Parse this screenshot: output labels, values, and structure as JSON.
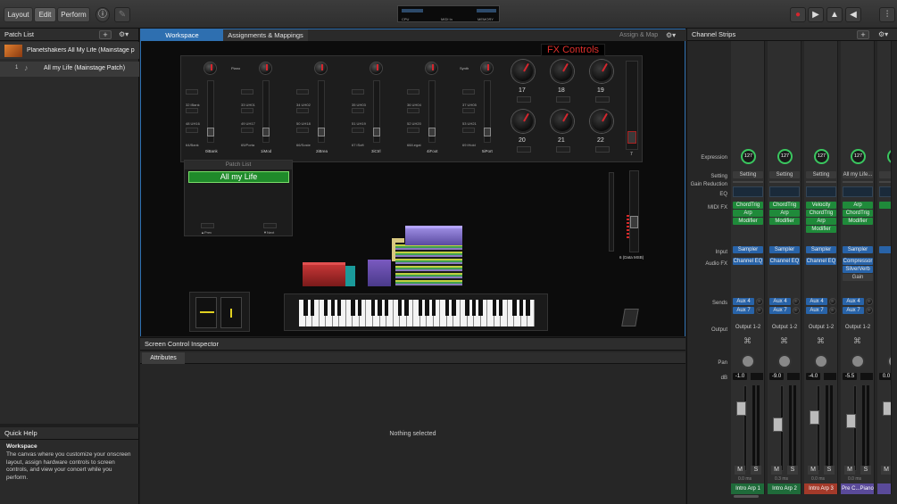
{
  "toolbar": {
    "layout": "Layout",
    "edit": "Edit",
    "perform": "Perform",
    "info_icon": "info-icon",
    "pencil_icon": "pencil-icon",
    "meters": {
      "cpu": "CPU",
      "midi": "MIDI In",
      "memory": "MEMORY"
    },
    "transport": [
      "record-icon",
      "play-icon",
      "metronome-icon",
      "back-icon"
    ],
    "mixer_icon": "mixer-icon"
  },
  "patch_list": {
    "title": "Patch List",
    "concert": "Planetshakers All My Life (Mainstage p",
    "patches": [
      {
        "number": "1",
        "name": "All my Life (Mainstage Patch)"
      }
    ]
  },
  "quick_help": {
    "title": "Quick Help",
    "subtitle": "Workspace",
    "body": "The canvas where you customize your onscreen layout, assign hardware controls to screen controls, and view your concert while you perform."
  },
  "workspace": {
    "tabs": [
      "Workspace",
      "Assignments & Mappings"
    ],
    "assign_map": "Assign & Map",
    "fx_title": "FX Controls",
    "top_labels": [
      "Piano",
      "Synth"
    ],
    "strip_buttons": [
      {
        "a": "32 iBank",
        "b": "48 UH16",
        "c": "64/Bank",
        "name": "0iBank"
      },
      {
        "a": "33 UH01",
        "b": "49 UH17",
        "c": "65/Porta",
        "name": "1iMod"
      },
      {
        "a": "34 UH02",
        "b": "50 UH18",
        "c": "66/Soste",
        "name": "2iBrea"
      },
      {
        "a": "35 UH03",
        "b": "51 UH19",
        "c": "67 iSoft",
        "name": "3iCtrl"
      },
      {
        "a": "36 UH04",
        "b": "52 UH20",
        "c": "68/Legat",
        "name": "4iFoot"
      },
      {
        "a": "37 UH05",
        "b": "53 UH21",
        "c": "69 iHold",
        "name": "5iPort"
      }
    ],
    "fx_knobs": [
      "17",
      "18",
      "19",
      "20",
      "21",
      "22"
    ],
    "slider_seven": "7",
    "patch_list_title": "Patch List",
    "patch_current": "All my Life",
    "prev": "▲Prev",
    "next": "▼Next",
    "data_msb": "6 (Data MSB)"
  },
  "inspector": {
    "title": "Screen Control Inspector",
    "tab": "Attributes",
    "empty": "Nothing selected"
  },
  "channel_strips": {
    "title": "Channel Strips",
    "row_labels": {
      "expression": "Expression",
      "setting": "Setting",
      "gain_reduction": "Gain Reduction",
      "eq": "EQ",
      "midi_fx": "MIDI FX",
      "input": "Input",
      "audio_fx": "Audio FX",
      "sends": "Sends",
      "output": "Output",
      "pan": "Pan",
      "db": "dB"
    },
    "strips": [
      {
        "expression": "127",
        "setting": "Setting",
        "midi_fx": [
          "ChordTrig",
          "Arp",
          "Modifier"
        ],
        "input": "Sampler",
        "audio_fx": [
          "Channel EQ"
        ],
        "sends": [
          "Aux 4",
          "Aux 7"
        ],
        "output": "Output 1-2",
        "db": "-1.0",
        "delay": "0.0 ms",
        "name": "Intro Arp 1",
        "color": "#1f6b3a"
      },
      {
        "expression": "127",
        "setting": "Setting",
        "midi_fx": [
          "ChordTrig",
          "Arp",
          "Modifier"
        ],
        "input": "Sampler",
        "audio_fx": [
          "Channel EQ"
        ],
        "sends": [
          "Aux 4",
          "Aux 7"
        ],
        "output": "Output 1-2",
        "db": "-9.0",
        "delay": "0.3 ms",
        "name": "Intro Arp 2",
        "color": "#1f6b3a"
      },
      {
        "expression": "127",
        "setting": "Setting",
        "midi_fx": [
          "Velocity",
          "ChordTrig",
          "Arp",
          "Modifier"
        ],
        "input": "Sampler",
        "audio_fx": [
          "Channel EQ"
        ],
        "sends": [
          "Aux 4",
          "Aux 7"
        ],
        "output": "Output 1-2",
        "db": "-4.0",
        "delay": "0.0 ms",
        "name": "Intro Arp 3",
        "color": "#a33a2a"
      },
      {
        "expression": "127",
        "setting": "All my Life...",
        "midi_fx": [
          "Arp",
          "ChordTrig",
          "Modifier"
        ],
        "input": "Sampler",
        "audio_fx": [
          "Compressor",
          "SilverVerb",
          "Gain"
        ],
        "sends": [
          "Aux 4",
          "Aux 7"
        ],
        "output": "Output 1-2",
        "db": "-5.5",
        "delay": "0.0 ms",
        "name": "Pre C...Piano",
        "color": "#5a4a9a"
      },
      {
        "expression": "12",
        "setting": "",
        "midi_fx": [
          "Ch"
        ],
        "input": "Ul",
        "audio_fx": [],
        "sends": [],
        "output": "",
        "db": "0.0",
        "delay": "",
        "name": "",
        "color": "#5a4a9a"
      }
    ],
    "mute": "M",
    "solo": "S"
  }
}
